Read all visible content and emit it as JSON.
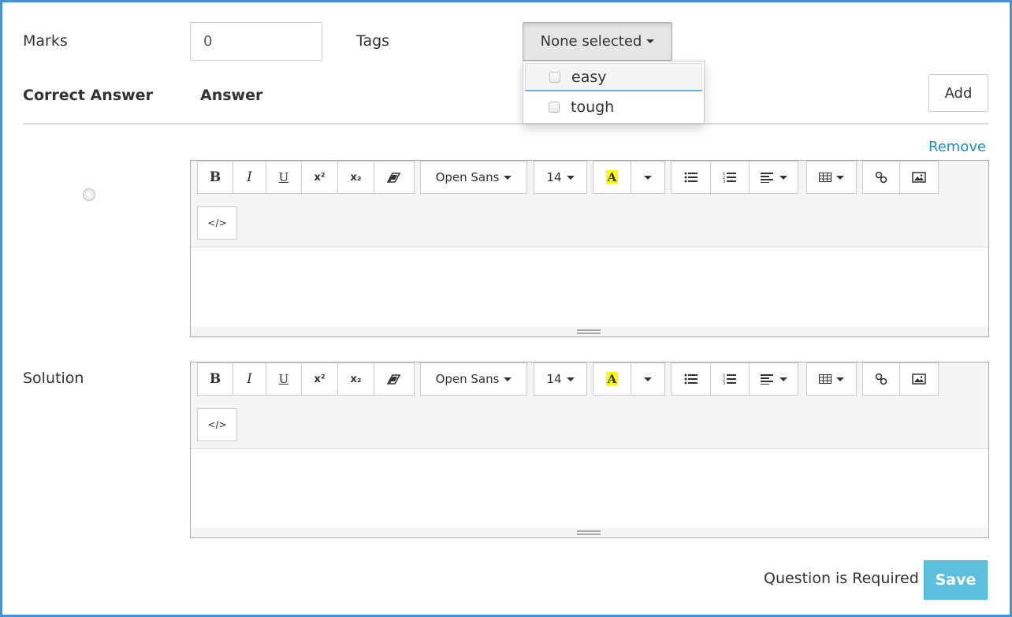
{
  "marks": {
    "label": "Marks",
    "value": "0"
  },
  "tags": {
    "label": "Tags",
    "button_label": "None selected",
    "options": [
      {
        "label": "easy",
        "checked": false
      },
      {
        "label": "tough",
        "checked": false
      }
    ]
  },
  "answers_header": {
    "correct_answer": "Correct Answer",
    "answer": "Answer",
    "add_label": "Add"
  },
  "answer_row": {
    "remove_label": "Remove",
    "selected": false
  },
  "toolbar": {
    "bold": "B",
    "italic": "I",
    "underline": "U",
    "superscript": "x²",
    "subscript": "x₂",
    "font_family": "Open Sans",
    "font_size": "14",
    "color_letter": "A",
    "codeview": "</>"
  },
  "solution": {
    "label": "Solution"
  },
  "footer": {
    "required_text": "Question is Required",
    "save_label": "Save"
  },
  "colors": {
    "accent": "#1a8fd1",
    "save_bg": "#5bc0de",
    "frame": "#4a90d9",
    "highlight": "#ffff00"
  }
}
